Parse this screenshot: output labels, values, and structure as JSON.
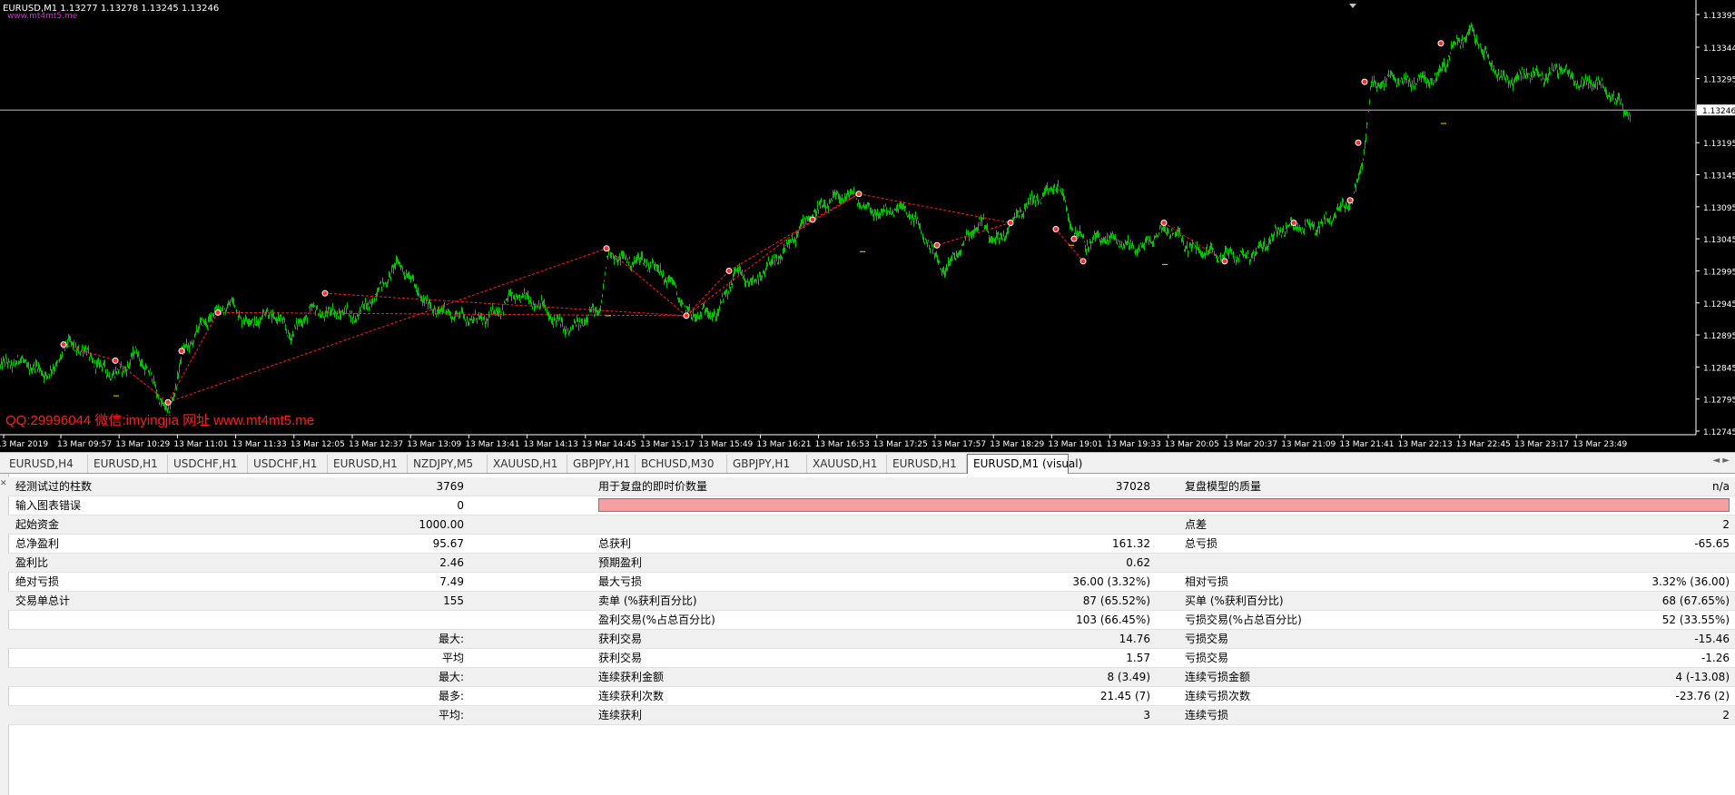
{
  "chart": {
    "info_line": "EURUSD,M1  1.13277 1.13278 1.13245 1.13246",
    "sub_line": "www.mt4mt5.me",
    "watermark": "QQ:29996044 微信:imyingjia 网址 www.mt4mt5.me",
    "current_price_label": "1.13246",
    "price_ticks": [
      "1.13395",
      "1.13344",
      "1.13295",
      "1.13246",
      "1.13195",
      "1.13145",
      "1.13095",
      "1.13045",
      "1.12995",
      "1.12945",
      "1.12895",
      "1.12845",
      "1.12795",
      "1.12745"
    ],
    "time_ticks": [
      "13 Mar 2019",
      "13 Mar 09:57",
      "13 Mar 10:29",
      "13 Mar 11:01",
      "13 Mar 11:33",
      "13 Mar 12:05",
      "13 Mar 12:37",
      "13 Mar 13:09",
      "13 Mar 13:41",
      "13 Mar 14:13",
      "13 Mar 14:45",
      "13 Mar 15:17",
      "13 Mar 15:49",
      "13 Mar 16:21",
      "13 Mar 16:53",
      "13 Mar 17:25",
      "13 Mar 17:57",
      "13 Mar 18:29",
      "13 Mar 19:01",
      "13 Mar 19:33",
      "13 Mar 20:05",
      "13 Mar 20:37",
      "13 Mar 21:09",
      "13 Mar 21:41",
      "13 Mar 22:13",
      "13 Mar 22:45",
      "13 Mar 23:17",
      "13 Mar 23:49"
    ],
    "colors": {
      "bars": "#00c000",
      "trade_line": "#ff2020",
      "background": "#000000",
      "axis_text": "#ffffff"
    }
  },
  "tabs": [
    {
      "label": "EURUSD,H4"
    },
    {
      "label": "EURUSD,H1"
    },
    {
      "label": "USDCHF,H1"
    },
    {
      "label": "USDCHF,H1"
    },
    {
      "label": "EURUSD,H1"
    },
    {
      "label": "NZDJPY,M5"
    },
    {
      "label": "XAUUSD,H1"
    },
    {
      "label": "GBPJPY,H1"
    },
    {
      "label": "BCHUSD,M30"
    },
    {
      "label": "GBPJPY,H1"
    },
    {
      "label": "XAUUSD,H1"
    },
    {
      "label": "EURUSD,H1"
    },
    {
      "label": "EURUSD,M1 (visual)"
    }
  ],
  "report": {
    "rows": [
      [
        "经测试过的柱数",
        "3769",
        "用于复盘的即时价数量",
        "37028",
        "复盘模型的质量",
        "n/a"
      ],
      [
        "输入图表错误",
        "0",
        "",
        "",
        "",
        ""
      ],
      [
        "起始资金",
        "1000.00",
        "",
        "",
        "点差",
        "2"
      ],
      [
        "总净盈利",
        "95.67",
        "总获利",
        "161.32",
        "总亏损",
        "-65.65"
      ],
      [
        "盈利比",
        "2.46",
        "预期盈利",
        "0.62",
        "",
        ""
      ],
      [
        "绝对亏损",
        "7.49",
        "最大亏损",
        "36.00 (3.32%)",
        "相对亏损",
        "3.32% (36.00)"
      ],
      [
        "交易单总计",
        "155",
        "卖单 (%获利百分比)",
        "87 (65.52%)",
        "买单 (%获利百分比)",
        "68 (67.65%)"
      ],
      [
        "",
        "",
        "盈利交易(%占总百分比)",
        "103 (66.45%)",
        "亏损交易(%占总百分比)",
        "52 (33.55%)"
      ],
      [
        "",
        "最大:",
        "获利交易",
        "14.76",
        "亏损交易",
        "-15.46"
      ],
      [
        "",
        "平均",
        "获利交易",
        "1.57",
        "亏损交易",
        "-1.26"
      ],
      [
        "",
        "最大:",
        "连续获利金额",
        "8 (3.49)",
        "连续亏损金额",
        "4 (-13.08)"
      ],
      [
        "",
        "最多:",
        "连续获利次数",
        "21.45 (7)",
        "连续亏损次数",
        "-23.76 (2)"
      ],
      [
        "",
        "平均:",
        "连续获利",
        "3",
        "连续亏损",
        "2"
      ]
    ]
  }
}
